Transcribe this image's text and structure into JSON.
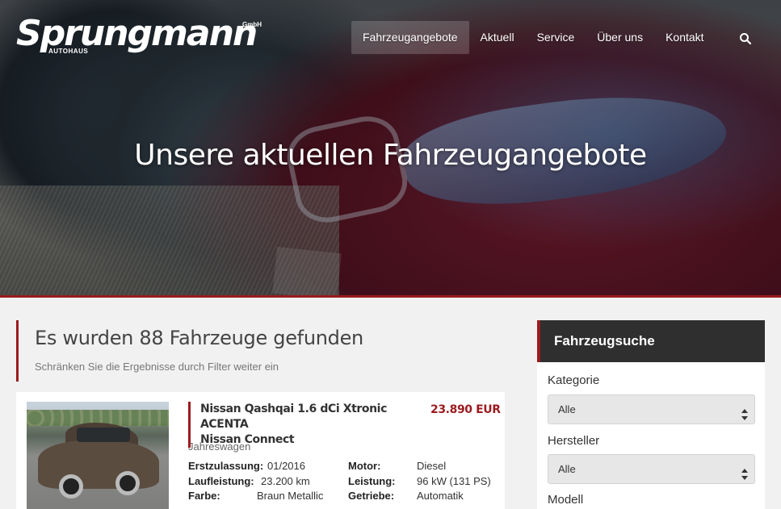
{
  "brand": {
    "name": "Sprungmann",
    "tagline": "AUTOHAUS",
    "suffix": "GmbH"
  },
  "nav": {
    "items": [
      {
        "label": "Fahrzeugangebote",
        "active": true
      },
      {
        "label": "Aktuell",
        "active": false
      },
      {
        "label": "Service",
        "active": false
      },
      {
        "label": "Über uns",
        "active": false
      },
      {
        "label": "Kontakt",
        "active": false
      }
    ],
    "search_icon": "search-icon"
  },
  "hero": {
    "title": "Unsere aktuellen Fahrzeugangebote"
  },
  "results": {
    "title": "Es wurden 88 Fahrzeuge gefunden",
    "subtitle": "Schränken Sie die Ergebnisse durch Filter weiter ein"
  },
  "listing": {
    "title_line1": "Nissan Qashqai 1.6 dCi Xtronic ACENTA",
    "title_line2": "Nissan Connect",
    "price": "23.890 EUR",
    "type": "Jahreswagen",
    "specs_left": [
      {
        "label": "Erstzulassung:",
        "value": "01/2016"
      },
      {
        "label": "Laufleistung:",
        "value": "23.200 km"
      },
      {
        "label": "Farbe:",
        "value": "Braun Metallic"
      }
    ],
    "specs_right": [
      {
        "label": "Motor:",
        "value": "Diesel"
      },
      {
        "label": "Leistung:",
        "value": "96 kW (131 PS)"
      },
      {
        "label": "Getriebe:",
        "value": "Automatik"
      }
    ]
  },
  "sidebar": {
    "title": "Fahrzeugsuche",
    "filters": [
      {
        "label": "Kategorie",
        "value": "Alle"
      },
      {
        "label": "Hersteller",
        "value": "Alle"
      },
      {
        "label": "Modell",
        "value": ""
      }
    ]
  },
  "colors": {
    "accent": "#9b1b1f",
    "sidebar_header": "#2f2f2f",
    "page_bg": "#f1f1f1"
  }
}
